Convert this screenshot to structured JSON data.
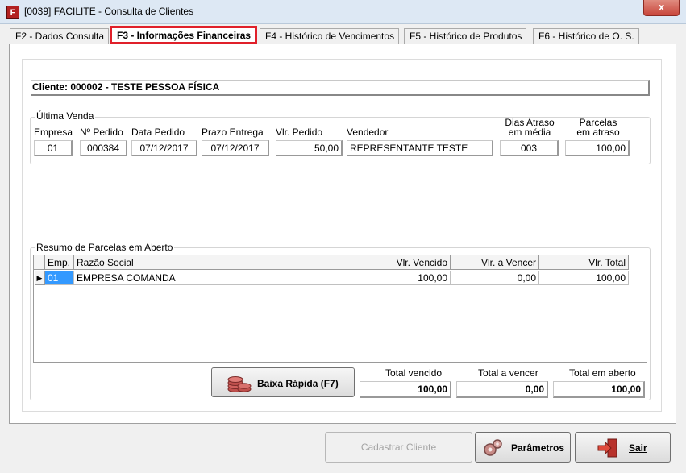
{
  "window": {
    "title": "[0039] FACILITE - Consulta de Clientes",
    "app_icon_glyph": "F",
    "close_glyph": "x"
  },
  "tabs": [
    {
      "label": "F2 - Dados Consulta",
      "active": false
    },
    {
      "label": "F3 - Informações Financeiras",
      "active": true
    },
    {
      "label": "F4 - Histórico de Vencimentos",
      "active": false
    },
    {
      "label": "F5 - Histórico de Produtos",
      "active": false
    },
    {
      "label": "F6 - Histórico de O. S.",
      "active": false
    }
  ],
  "client": {
    "label": "Cliente: 000002 - TESTE PESSOA FÍSICA"
  },
  "ultima_venda": {
    "title": "Última Venda",
    "labels": {
      "empresa": "Empresa",
      "pedido": "Nº Pedido",
      "data_pedido": "Data Pedido",
      "prazo_entrega": "Prazo Entrega",
      "vlr_pedido": "Vlr. Pedido",
      "vendedor": "Vendedor",
      "dias_atraso_1": "Dias Atraso",
      "dias_atraso_2": "em média",
      "parcelas_1": "Parcelas",
      "parcelas_2": "em atraso"
    },
    "values": {
      "empresa": "01",
      "pedido": "000384",
      "data_pedido": "07/12/2017",
      "prazo_entrega": "07/12/2017",
      "vlr_pedido": "50,00",
      "vendedor": "REPRESENTANTE TESTE",
      "dias_atraso": "003",
      "parcelas": "100,00"
    }
  },
  "resumo": {
    "title": "Resumo de Parcelas em Aberto",
    "columns": [
      "Emp.",
      "Razão Social",
      "Vlr. Vencido",
      "Vlr. a Vencer",
      "Vlr. Total"
    ],
    "rows": [
      {
        "emp": "01",
        "razao": "EMPRESA COMANDA",
        "vencido": "100,00",
        "a_vencer": "0,00",
        "total": "100,00"
      }
    ],
    "row_indicator": "▶"
  },
  "totals": {
    "vencido_label": "Total vencido",
    "vencido_value": "100,00",
    "a_vencer_label": "Total a vencer",
    "a_vencer_value": "0,00",
    "em_aberto_label": "Total em aberto",
    "em_aberto_value": "100,00"
  },
  "buttons": {
    "baixa_rapida": "Baixa Rápida (F7)",
    "cadastrar_cliente": "Cadastrar Cliente",
    "parametros": "Parâmetros",
    "sair": "Sair"
  },
  "icons": {
    "baixa_rapida": "coins-stack-icon",
    "parametros": "gears-icon",
    "sair": "exit-door-icon"
  },
  "colors": {
    "active_tab_border": "#e0202a",
    "selected_cell": "#3399ff"
  }
}
